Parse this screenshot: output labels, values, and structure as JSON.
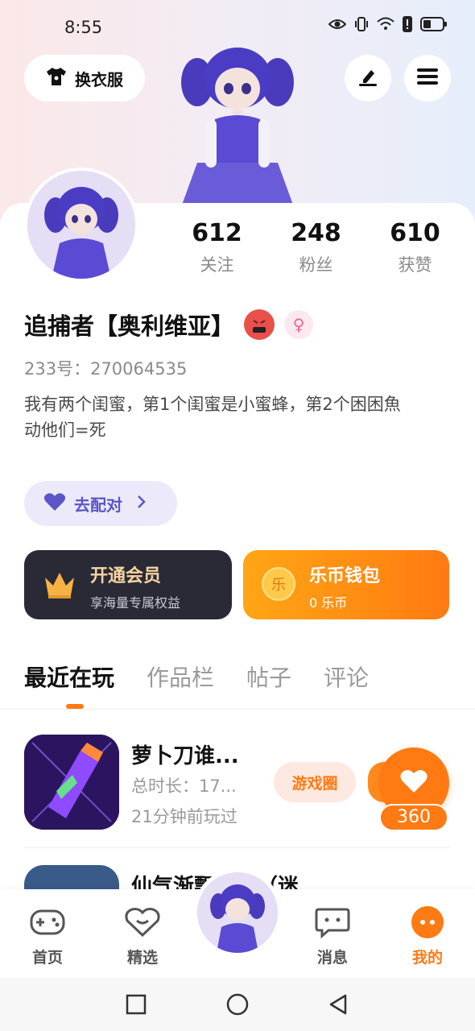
{
  "status_bar": {
    "time": "8:55"
  },
  "header": {
    "outfit_label": "换衣服",
    "edit_icon": "pen-icon",
    "menu_icon": "menu-icon"
  },
  "profile": {
    "stats": [
      {
        "value": "612",
        "label": "关注"
      },
      {
        "value": "248",
        "label": "粉丝"
      },
      {
        "value": "610",
        "label": "获赞"
      }
    ],
    "username": "追捕者【奥利维亚】",
    "id": "233号：270064535",
    "bio_line1": "我有两个闺蜜，第1个闺蜜是小蜜蜂，第2个困困魚",
    "bio_line2": "动他们=死",
    "match_label": "去配对"
  },
  "cards": {
    "vip_title": "开通会员",
    "vip_sub": "享海量专属权益",
    "wallet_title": "乐币钱包",
    "wallet_sub": "0 乐币",
    "wallet_coin": "乐"
  },
  "tabs": [
    "最近在玩",
    "作品栏",
    "帖子",
    "评论"
  ],
  "games": [
    {
      "name": "萝卜刀谁...",
      "duration": "总时长：17...",
      "last_played": "21分钟前玩过",
      "circle_label": "游戏圈",
      "likes": "360"
    },
    {
      "name": "仙气渐飘梦境（迷..."
    }
  ],
  "bottom_nav": [
    {
      "label": "首页",
      "icon": "gamepad-icon"
    },
    {
      "label": "精选",
      "icon": "heart-shield-icon"
    },
    {
      "label": "消息",
      "icon": "chat-icon"
    },
    {
      "label": "我的",
      "icon": "profile-face-icon"
    }
  ],
  "colors": {
    "accent": "#ff7a12",
    "match": "#5b55c9",
    "vip_bg": "#2a2a36"
  }
}
